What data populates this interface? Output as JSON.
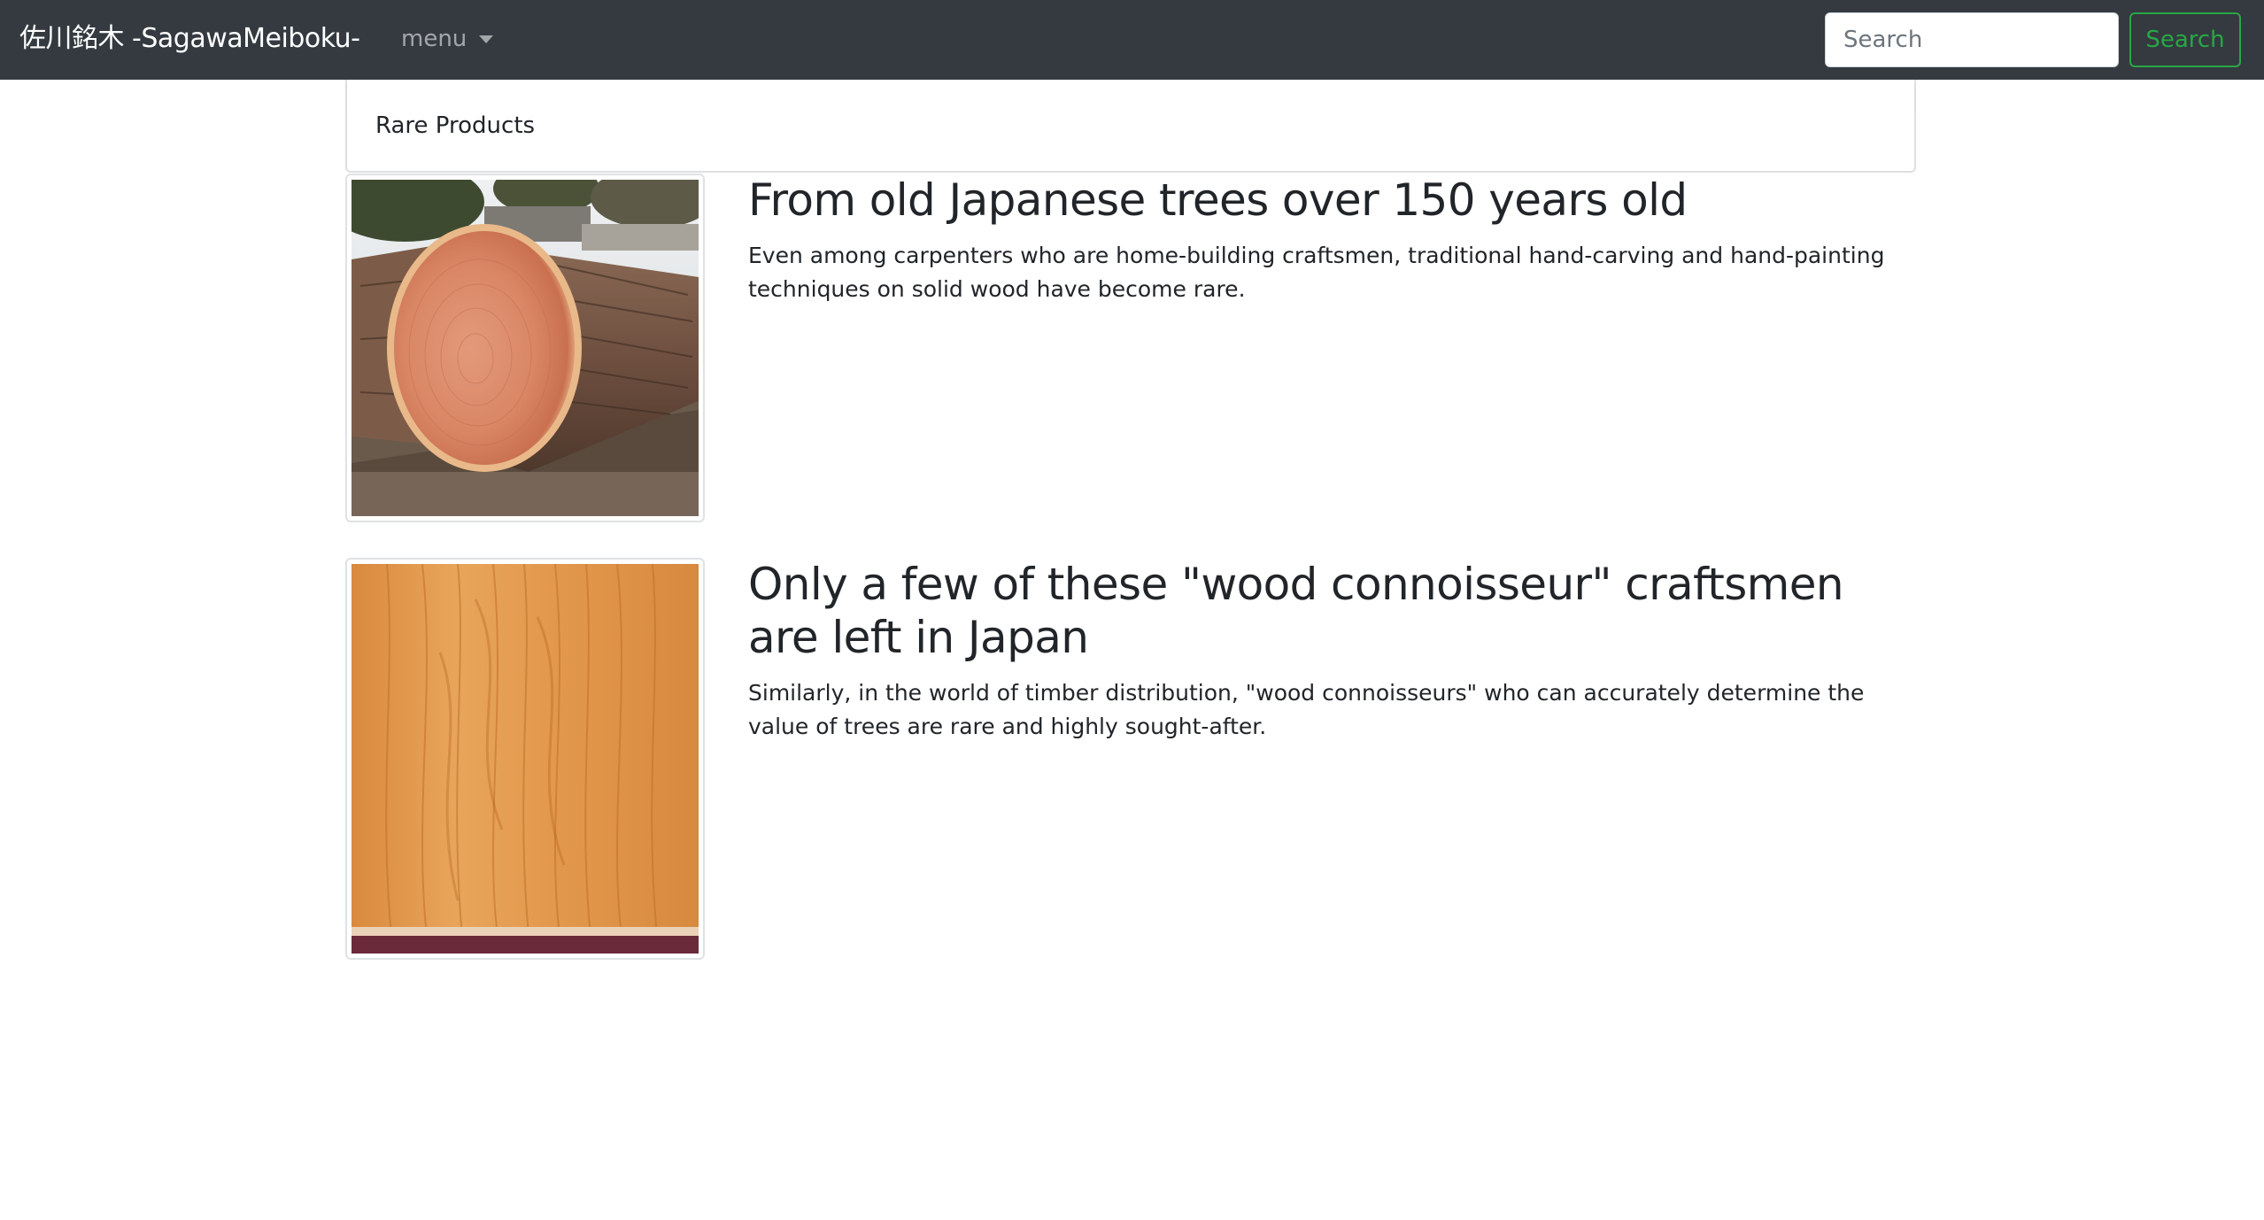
{
  "navbar": {
    "brand": "佐川銘木 -SagawaMeiboku-",
    "menu_label": "menu",
    "search_placeholder": "Search",
    "search_button": "Search"
  },
  "breadcrumb": {
    "label": "Rare Products"
  },
  "articles": [
    {
      "image_subject": "cut log cross-section",
      "title": "From old Japanese trees over 150 years old",
      "text": "Even among carpenters who are home-building craftsmen, traditional hand-carving and hand-painting techniques on solid wood have become rare."
    },
    {
      "image_subject": "wood grain plank",
      "title": "Only a few of these \"wood connoisseur\" craftsmen are left in Japan",
      "text": "Similarly, in the world of timber distribution, \"wood connoisseurs\" who can accurately determine the value of trees are rare and highly sought-after."
    }
  ],
  "colors": {
    "navbar_bg": "#343a40",
    "accent_green": "#28a745",
    "text": "#212529"
  }
}
